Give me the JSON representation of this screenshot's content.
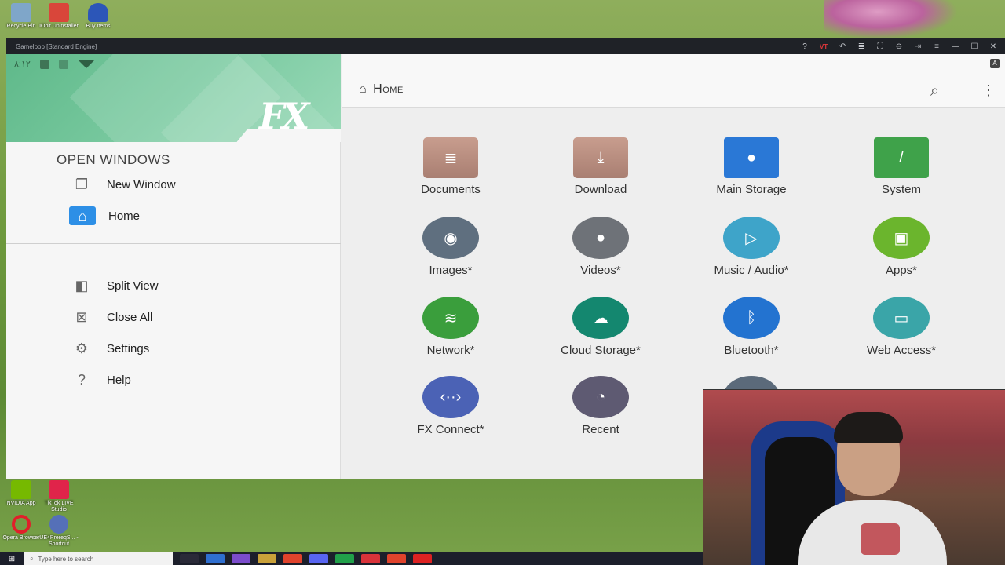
{
  "desktop": {
    "icons_top": [
      {
        "label": "Recycle Bin",
        "color": "#7fa6c9"
      },
      {
        "label": "IObit Uninstaller",
        "color": "#d9463a"
      },
      {
        "label": "Buy Items",
        "color": "#2c56b8"
      }
    ],
    "icons_bottom": [
      {
        "label": "NVIDIA App",
        "color": "#76b900"
      },
      {
        "label": "TikTok LIVE Studio",
        "color": "#e0244a"
      },
      {
        "label": "Opera Browser",
        "color": "#e0202a"
      },
      {
        "label": "UE4PrereqS... - Shortcut",
        "color": "#5570b8"
      }
    ]
  },
  "emulator": {
    "title": "Gameloop [Standard Engine]",
    "controls": [
      "?",
      "VT",
      "↶",
      "≣",
      "⛶",
      "⊖",
      "⇥",
      "≡",
      "—",
      "☐",
      "✕"
    ]
  },
  "status": {
    "time": "٨:١٢"
  },
  "drawer": {
    "logo": "FX",
    "section_title": "OPEN WINDOWS",
    "items": [
      {
        "label": "New Window",
        "icon": "new-window-icon",
        "glyph": "❐"
      },
      {
        "label": "Home",
        "icon": "home-icon",
        "glyph": "⌂"
      }
    ],
    "actions": [
      {
        "label": "Split View",
        "icon": "split-view-icon",
        "glyph": "◧"
      },
      {
        "label": "Close All",
        "icon": "close-all-icon",
        "glyph": "⊠"
      },
      {
        "label": "Settings",
        "icon": "gear-icon",
        "glyph": "⚙"
      },
      {
        "label": "Help",
        "icon": "help-icon",
        "glyph": "?"
      }
    ]
  },
  "toolbar": {
    "breadcrumb": "Home",
    "search_icon": "search-icon",
    "more_icon": "more-vert-icon",
    "badge": "A"
  },
  "grid": [
    {
      "label": "Documents",
      "kind": "folder",
      "color": "#b88b7c",
      "glyph": "≣"
    },
    {
      "label": "Download",
      "kind": "folder",
      "color": "#b88b7c",
      "glyph": "⤓"
    },
    {
      "label": "Main Storage",
      "kind": "square",
      "color": "#2a78d6",
      "glyph": "●"
    },
    {
      "label": "System",
      "kind": "square",
      "color": "#3fa24a",
      "glyph": "/"
    },
    {
      "label": "Images*",
      "kind": "round",
      "color": "#5f6f7f",
      "glyph": "◉"
    },
    {
      "label": "Videos*",
      "kind": "round",
      "color": "#6e7278",
      "glyph": "●"
    },
    {
      "label": "Music / Audio*",
      "kind": "round",
      "color": "#3ea4c9",
      "glyph": "▷"
    },
    {
      "label": "Apps*",
      "kind": "round",
      "color": "#6bb52d",
      "glyph": "▣"
    },
    {
      "label": "Network*",
      "kind": "round",
      "color": "#3a9e3c",
      "glyph": "≋"
    },
    {
      "label": "Cloud Storage*",
      "kind": "round",
      "color": "#14876f",
      "glyph": "☁"
    },
    {
      "label": "Bluetooth*",
      "kind": "round",
      "color": "#2373d0",
      "glyph": "ᛒ"
    },
    {
      "label": "Web Access*",
      "kind": "round",
      "color": "#3aa5a8",
      "glyph": "▭"
    },
    {
      "label": "FX Connect*",
      "kind": "round",
      "color": "#4b62b5",
      "glyph": "‹··›"
    },
    {
      "label": "Recent",
      "kind": "round",
      "color": "#5e5a72",
      "glyph": "◔"
    },
    {
      "label": "",
      "kind": "round",
      "color": "#5b6a7a",
      "glyph": "?"
    }
  ],
  "taskbar": {
    "search_placeholder": "Type here to search",
    "apps": [
      "#2a2a38",
      "#2f6fd0",
      "#7b4ccc",
      "#c9a13a",
      "#e0432c",
      "#5865f2",
      "#21a04a",
      "#d9333a",
      "#e0432c",
      "#d22"
    ]
  }
}
